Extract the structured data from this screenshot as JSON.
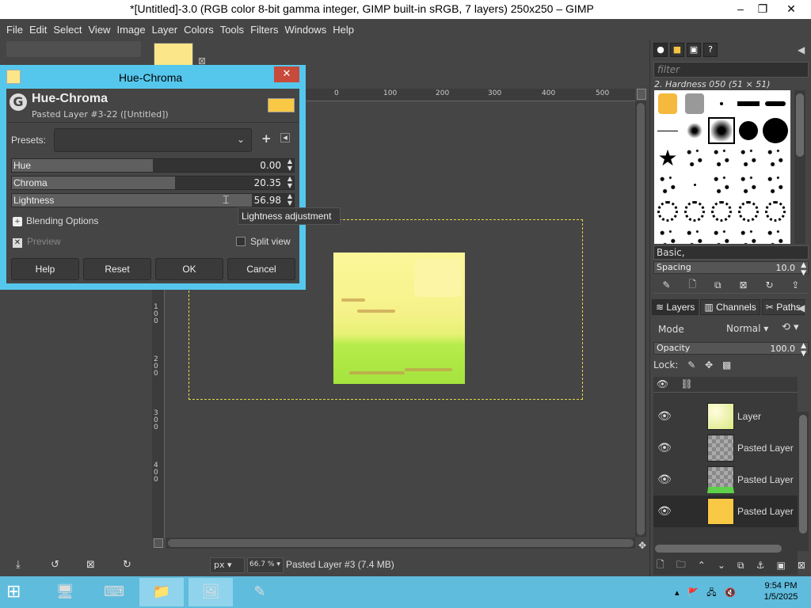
{
  "window": {
    "title": "*[Untitled]-3.0 (RGB color 8-bit gamma integer, GIMP built-in sRGB, 7 layers) 250x250 – GIMP",
    "minimize": "–",
    "maximize": "❐",
    "close": "✕"
  },
  "menu": [
    "File",
    "Edit",
    "Select",
    "View",
    "Image",
    "Layer",
    "Colors",
    "Tools",
    "Filters",
    "Windows",
    "Help"
  ],
  "ruler": {
    "h_ticks": [
      "0",
      "100",
      "200",
      "300",
      "400",
      "500"
    ],
    "v_ticks": [
      "100",
      "200",
      "300",
      "400"
    ]
  },
  "statusbar": {
    "unit": "px",
    "zoom": "66.7 %",
    "message": "Pasted Layer #3 (7.4 MB)"
  },
  "dialog": {
    "window_title": "Hue-Chroma",
    "close": "✕",
    "heading": "Hue-Chroma",
    "subheading": "Pasted Layer #3-22 ([Untitled])",
    "presets_label": "Presets:",
    "presets_value": "",
    "sliders": {
      "hue": {
        "label": "Hue",
        "value": "0.00",
        "fill": 0.5
      },
      "chroma": {
        "label": "Chroma",
        "value": "20.35",
        "fill": 0.58
      },
      "lightness": {
        "label": "Lightness",
        "value": "56.98",
        "fill": 0.85
      }
    },
    "blending_options": "Blending Options",
    "preview": "Preview",
    "preview_checked": true,
    "split_view": "Split view",
    "split_view_checked": false,
    "buttons": {
      "help": "Help",
      "reset": "Reset",
      "ok": "OK",
      "cancel": "Cancel"
    },
    "tooltip": "Lightness adjustment"
  },
  "brushes": {
    "filter_placeholder": "filter",
    "selected_brush": "2. Hardness 050 (51 × 51)",
    "tag": "Basic,",
    "spacing_label": "Spacing",
    "spacing_value": "10.0"
  },
  "layers": {
    "tabs": [
      "Layers",
      "Channels",
      "Paths"
    ],
    "mode_label": "Mode",
    "mode_value": "Normal",
    "opacity_label": "Opacity",
    "opacity_value": "100.0",
    "lock_label": "Lock:",
    "items": [
      {
        "name": "Layer",
        "visible": true
      },
      {
        "name": "Pasted Layer",
        "visible": true
      },
      {
        "name": "Pasted Layer",
        "visible": true
      },
      {
        "name": "Pasted Layer",
        "visible": true,
        "active": true
      }
    ]
  },
  "taskbar": {
    "time": "9:54 PM",
    "date": "1/5/2025"
  },
  "colors": {
    "dialog_frame": "#55c7ec",
    "taskbar": "#5fbcdd",
    "close_button": "#c74a3a",
    "dark_bg": "#454545"
  }
}
